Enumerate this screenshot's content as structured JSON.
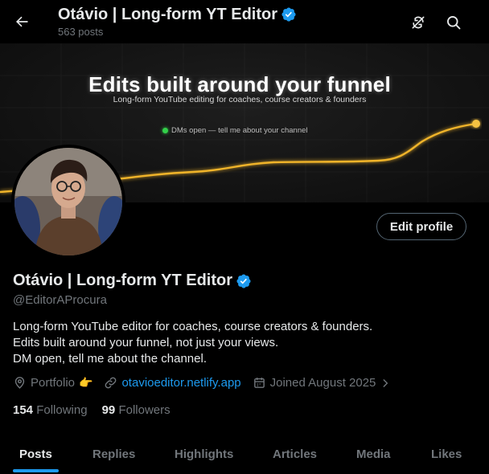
{
  "header": {
    "title": "Otávio | Long-form YT Editor",
    "post_count": "563 posts"
  },
  "banner": {
    "headline": "Edits built around your funnel",
    "subline": "Long-form YouTube editing for coaches, course creators & founders",
    "status": "DMs open — tell me about your channel"
  },
  "profile": {
    "name": "Otávio | Long-form YT Editor",
    "handle": "@EditorAProcura",
    "edit_label": "Edit profile",
    "bio": [
      "Long-form YouTube editor for coaches, course creators & founders.",
      "Edits built around your funnel, not just your views.",
      "DM open, tell me about the channel."
    ],
    "location": "Portfolio",
    "location_emoji": "👉",
    "website": "otavioeditor.netlify.app",
    "joined": "Joined August 2025",
    "following_count": "154",
    "following_label": "Following",
    "followers_count": "99",
    "followers_label": "Followers"
  },
  "tabs": [
    {
      "label": "Posts",
      "active": true
    },
    {
      "label": "Replies",
      "active": false
    },
    {
      "label": "Highlights",
      "active": false
    },
    {
      "label": "Articles",
      "active": false
    },
    {
      "label": "Media",
      "active": false
    },
    {
      "label": "Likes",
      "active": false
    }
  ],
  "colors": {
    "accent": "#1d9bf0",
    "funnel_line": "#f0b429",
    "dm_dot": "#33d04a"
  }
}
